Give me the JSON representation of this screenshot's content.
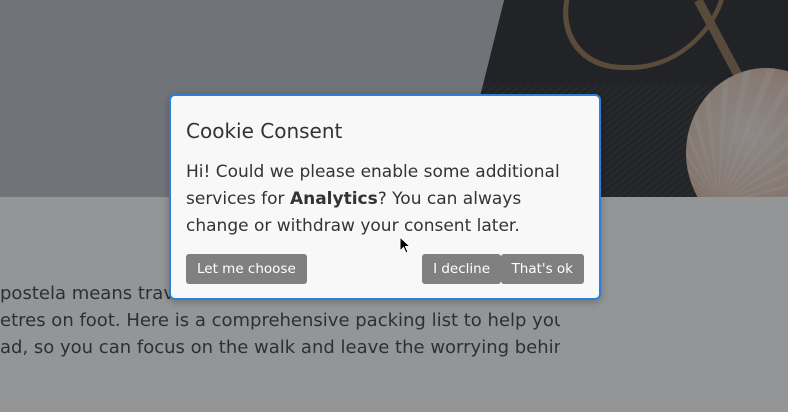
{
  "background_page": {
    "body_lines": [
      "postela means travel",
      "etres on foot. Here is a comprehensive packing list to help you",
      "ad, so you can focus on the walk and leave the worrying behind."
    ]
  },
  "modal": {
    "title": "Cookie Consent",
    "text_before": "Hi! Could we please enable some additional services for ",
    "text_bold": "Analytics",
    "text_after": "? You can always change or withdraw your consent later.",
    "buttons": {
      "choose": "Let me choose",
      "decline": "I decline",
      "accept": "That's ok"
    }
  },
  "colors": {
    "modal_border": "#2f7fd6",
    "button_bg": "#808080",
    "overlay": "rgba(40,44,48,0.5)"
  },
  "icons": {
    "cursor": "mouse-pointer-icon"
  }
}
